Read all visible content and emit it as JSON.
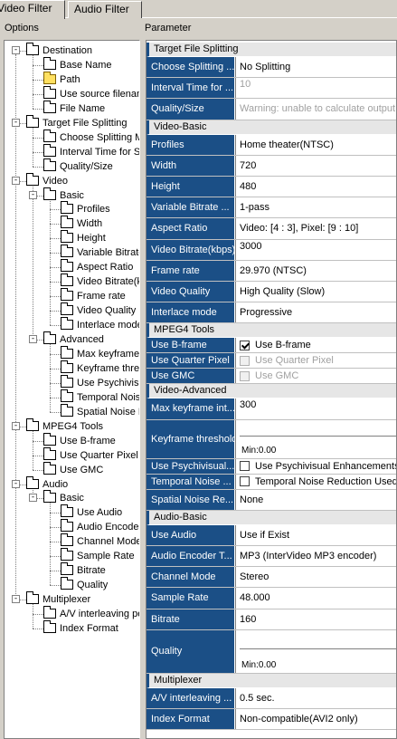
{
  "tabs": {
    "video": "Video Filter",
    "audio": "Audio Filter"
  },
  "headers": {
    "options": "Options",
    "parameter": "Parameter"
  },
  "tree": [
    {
      "label": "Destination",
      "depth": 0,
      "exp": "-",
      "open": false
    },
    {
      "label": "Base Name",
      "depth": 1,
      "exp": "",
      "open": false
    },
    {
      "label": "Path",
      "depth": 1,
      "exp": "",
      "open": true
    },
    {
      "label": "Use source filenam",
      "depth": 1,
      "exp": "",
      "open": false
    },
    {
      "label": "File Name",
      "depth": 1,
      "exp": "",
      "open": false
    },
    {
      "label": "Target File Splitting",
      "depth": 0,
      "exp": "-",
      "open": false
    },
    {
      "label": "Choose Splitting M",
      "depth": 1,
      "exp": "",
      "open": false
    },
    {
      "label": "Interval Time for S",
      "depth": 1,
      "exp": "",
      "open": false
    },
    {
      "label": "Quality/Size",
      "depth": 1,
      "exp": "",
      "open": false
    },
    {
      "label": "Video",
      "depth": 0,
      "exp": "-",
      "open": false
    },
    {
      "label": "Basic",
      "depth": 1,
      "exp": "-",
      "open": false
    },
    {
      "label": "Profiles",
      "depth": 2,
      "exp": "",
      "open": false
    },
    {
      "label": "Width",
      "depth": 2,
      "exp": "",
      "open": false
    },
    {
      "label": "Height",
      "depth": 2,
      "exp": "",
      "open": false
    },
    {
      "label": "Variable Bitrate",
      "depth": 2,
      "exp": "",
      "open": false
    },
    {
      "label": "Aspect Ratio",
      "depth": 2,
      "exp": "",
      "open": false
    },
    {
      "label": "Video Bitrate(k",
      "depth": 2,
      "exp": "",
      "open": false
    },
    {
      "label": "Frame rate",
      "depth": 2,
      "exp": "",
      "open": false
    },
    {
      "label": "Video Quality",
      "depth": 2,
      "exp": "",
      "open": false
    },
    {
      "label": "Interlace mode",
      "depth": 2,
      "exp": "",
      "open": false
    },
    {
      "label": "Advanced",
      "depth": 1,
      "exp": "-",
      "open": false
    },
    {
      "label": "Max keyframe",
      "depth": 2,
      "exp": "",
      "open": false
    },
    {
      "label": "Keyframe thres",
      "depth": 2,
      "exp": "",
      "open": false
    },
    {
      "label": "Use Psychivisu",
      "depth": 2,
      "exp": "",
      "open": false
    },
    {
      "label": "Temporal Noise",
      "depth": 2,
      "exp": "",
      "open": false
    },
    {
      "label": "Spatial Noise F",
      "depth": 2,
      "exp": "",
      "open": false
    },
    {
      "label": "MPEG4 Tools",
      "depth": 0,
      "exp": "-",
      "open": false
    },
    {
      "label": "Use B-frame",
      "depth": 1,
      "exp": "",
      "open": false
    },
    {
      "label": "Use Quarter Pixel",
      "depth": 1,
      "exp": "",
      "open": false
    },
    {
      "label": "Use GMC",
      "depth": 1,
      "exp": "",
      "open": false
    },
    {
      "label": "Audio",
      "depth": 0,
      "exp": "-",
      "open": false
    },
    {
      "label": "Basic",
      "depth": 1,
      "exp": "-",
      "open": false
    },
    {
      "label": "Use Audio",
      "depth": 2,
      "exp": "",
      "open": false
    },
    {
      "label": "Audio Encode",
      "depth": 2,
      "exp": "",
      "open": false
    },
    {
      "label": "Channel Mode",
      "depth": 2,
      "exp": "",
      "open": false
    },
    {
      "label": "Sample Rate",
      "depth": 2,
      "exp": "",
      "open": false
    },
    {
      "label": "Bitrate",
      "depth": 2,
      "exp": "",
      "open": false
    },
    {
      "label": "Quality",
      "depth": 2,
      "exp": "",
      "open": false
    },
    {
      "label": "Multiplexer",
      "depth": 0,
      "exp": "-",
      "open": false
    },
    {
      "label": "A/V interleaving pe",
      "depth": 1,
      "exp": "",
      "open": false
    },
    {
      "label": "Index Format",
      "depth": 1,
      "exp": "",
      "open": false
    }
  ],
  "grid": [
    {
      "type": "section",
      "label": "Target File Splitting"
    },
    {
      "type": "prop",
      "name": "Choose Splitting ...",
      "value": "No Splitting"
    },
    {
      "type": "prop",
      "name": "Interval Time for ...",
      "value": "10",
      "disabled": true
    },
    {
      "type": "prop",
      "name": "Quality/Size",
      "value": "Warning: unable to calculate output fi",
      "disabled": true
    },
    {
      "type": "section",
      "label": "Video-Basic"
    },
    {
      "type": "prop",
      "name": "Profiles",
      "value": "Home theater(NTSC)"
    },
    {
      "type": "prop",
      "name": "Width",
      "value": "720"
    },
    {
      "type": "prop",
      "name": "Height",
      "value": "480"
    },
    {
      "type": "prop",
      "name": "Variable Bitrate ...",
      "value": "1-pass"
    },
    {
      "type": "prop",
      "name": "Aspect Ratio",
      "value": "Video: [4 : 3], Pixel: [9 : 10]"
    },
    {
      "type": "prop",
      "name": "Video Bitrate(kbps)",
      "value": "3000"
    },
    {
      "type": "prop",
      "name": "Frame rate",
      "value": "29.970 (NTSC)"
    },
    {
      "type": "prop",
      "name": "Video Quality",
      "value": "High Quality (Slow)"
    },
    {
      "type": "prop",
      "name": "Interlace mode",
      "value": "Progressive"
    },
    {
      "type": "section",
      "label": "MPEG4 Tools"
    },
    {
      "type": "check",
      "name": "Use B-frame",
      "value": "Use B-frame",
      "checked": true
    },
    {
      "type": "check",
      "name": "Use Quarter Pixel",
      "value": "Use Quarter Pixel",
      "disabled": true
    },
    {
      "type": "check",
      "name": "Use GMC",
      "value": "Use GMC",
      "disabled": true
    },
    {
      "type": "section",
      "label": "Video-Advanced"
    },
    {
      "type": "prop",
      "name": "Max keyframe int...",
      "value": "300"
    },
    {
      "type": "slider",
      "name": "Keyframe threshold",
      "value": "Min:0.00"
    },
    {
      "type": "check",
      "name": "Use Psychivisual...",
      "value": "Use Psychivisual Enhancements"
    },
    {
      "type": "check",
      "name": "Temporal Noise ...",
      "value": "Temporal Noise Reduction Used"
    },
    {
      "type": "prop",
      "name": "Spatial Noise Re...",
      "value": "None"
    },
    {
      "type": "section",
      "label": "Audio-Basic"
    },
    {
      "type": "prop",
      "name": "Use Audio",
      "value": "Use if Exist"
    },
    {
      "type": "prop",
      "name": "Audio Encoder T...",
      "value": "MP3 (InterVideo MP3 encoder)"
    },
    {
      "type": "prop",
      "name": "Channel Mode",
      "value": "Stereo"
    },
    {
      "type": "prop",
      "name": "Sample Rate",
      "value": "48.000"
    },
    {
      "type": "prop",
      "name": "Bitrate",
      "value": "160"
    },
    {
      "type": "slider",
      "name": "Quality",
      "value": "Min:0.00"
    },
    {
      "type": "section",
      "label": "Multiplexer"
    },
    {
      "type": "prop",
      "name": "A/V interleaving ...",
      "value": "0.5 sec."
    },
    {
      "type": "prop",
      "name": "Index Format",
      "value": "Non-compatible(AVI2 only)"
    }
  ],
  "colors": {
    "name_bg": "#1b4f86",
    "section_bg": "#e6e6e6"
  }
}
